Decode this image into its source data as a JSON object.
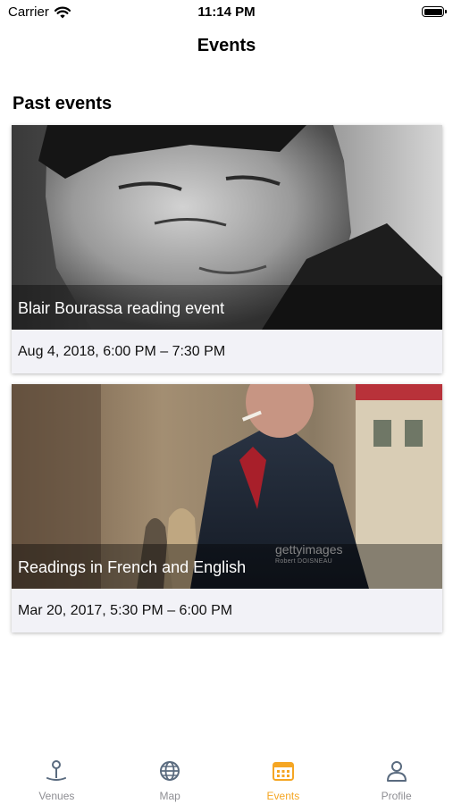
{
  "status_bar": {
    "carrier": "Carrier",
    "time": "11:14 PM",
    "icons": [
      "wifi-icon",
      "battery-icon"
    ]
  },
  "nav": {
    "title": "Events"
  },
  "section": {
    "title": "Past events"
  },
  "events": [
    {
      "title": "Blair Bourassa reading event",
      "date": "Aug 4, 2018, 6:00 PM – 7:30 PM"
    },
    {
      "title": "Readings in French and English",
      "date": "Mar 20, 2017, 5:30 PM – 6:00 PM",
      "watermark": "gettyimages",
      "credit": "Robert DOISNEAU"
    }
  ],
  "tabs": [
    {
      "label": "Venues",
      "icon": "venue-pin-icon",
      "active": false
    },
    {
      "label": "Map",
      "icon": "globe-icon",
      "active": false
    },
    {
      "label": "Events",
      "icon": "calendar-icon",
      "active": true
    },
    {
      "label": "Profile",
      "icon": "person-icon",
      "active": false
    }
  ],
  "colors": {
    "accent": "#f5a623",
    "tab_inactive": "#8e8e93",
    "card_background": "#f2f2f7"
  }
}
